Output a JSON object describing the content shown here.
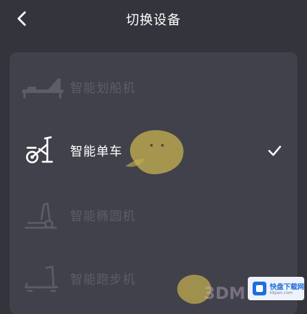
{
  "header": {
    "title": "切换设备",
    "back_icon": "chevron-left-icon"
  },
  "devices": [
    {
      "label": "智能划船机",
      "icon": "rowing-machine-icon",
      "selected": false
    },
    {
      "label": "智能单车",
      "icon": "exercise-bike-icon",
      "selected": true
    },
    {
      "label": "智能椭圆机",
      "icon": "elliptical-trainer-icon",
      "selected": false
    },
    {
      "label": "智能跑步机",
      "icon": "treadmill-icon",
      "selected": false
    }
  ],
  "selected_indicator": "checkmark-icon",
  "watermark": {
    "text": "3DM",
    "badge_title": "快盘下载网",
    "badge_sub": "kkpan.com"
  },
  "colors": {
    "background": "#34343d",
    "card": "#41414b",
    "active_text": "#ffffff",
    "dim_text": "#5d5d67"
  }
}
